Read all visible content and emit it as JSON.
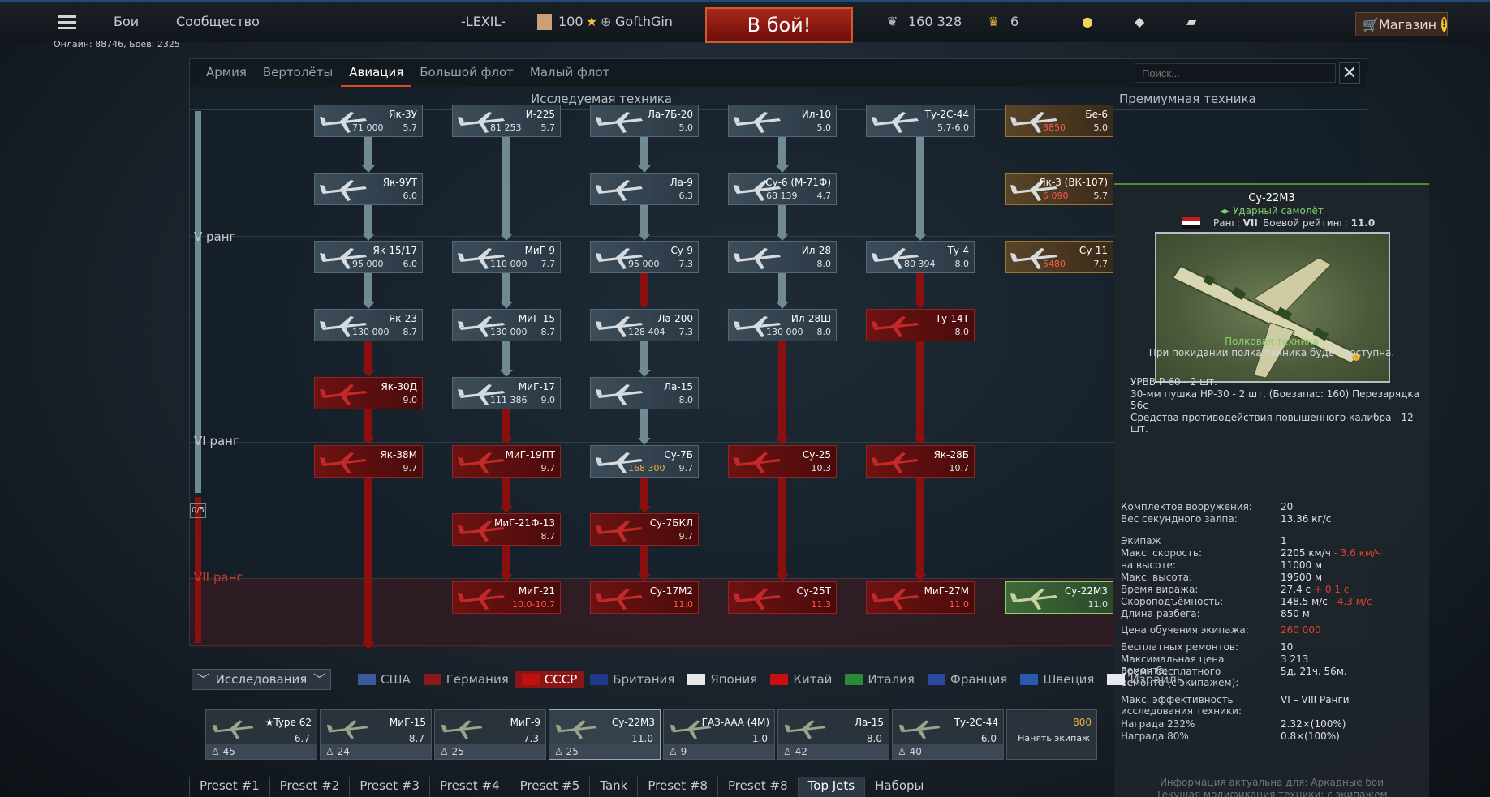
{
  "topbar": {
    "menu_icon": "hamburger-icon",
    "battles": "Бои",
    "community": "Сообщество",
    "squad_tag": "-LEXIL-",
    "level": "100",
    "nickname": "GofthGin",
    "fight_button": "В бой!",
    "silver_lions": "160 328",
    "golden_eagles": "6",
    "shop": "Магазин",
    "online": "Онлайн: 88746, Боёв: 2325"
  },
  "tabs": [
    "Армия",
    "Вертолёты",
    "Авиация",
    "Большой флот",
    "Малый флот"
  ],
  "active_tab": "Авиация",
  "search_placeholder": "Поиск...",
  "sections": {
    "researchable": "Исследуемая техника",
    "premium": "Премиумная техника"
  },
  "ranks": {
    "v": "V ранг",
    "vi": "VI ранг",
    "vii": "VII ранг",
    "progress": "0/5"
  },
  "tree": [
    {
      "id": "yak3u",
      "name": "Як-3У",
      "rp": "71 000",
      "br": "5.7",
      "state": "normal"
    },
    {
      "id": "i225",
      "name": "И-225",
      "rp": "81 253",
      "br": "5.7",
      "state": "normal"
    },
    {
      "id": "la7b20",
      "name": "Ла-7Б-20",
      "rp": "",
      "br": "5.0",
      "state": "normal"
    },
    {
      "id": "il10",
      "name": "Ил-10",
      "rp": "",
      "br": "5.0",
      "state": "normal"
    },
    {
      "id": "tu2s44",
      "name": "Ту-2С-44",
      "rp": "",
      "br": "5.7-6.0",
      "state": "normal"
    },
    {
      "id": "yak9ut",
      "name": "Як-9УТ",
      "rp": "",
      "br": "6.0",
      "state": "normal"
    },
    {
      "id": "la9",
      "name": "Ла-9",
      "rp": "",
      "br": "6.3",
      "state": "normal"
    },
    {
      "id": "su6",
      "name": "Су-6 (М-71Ф)",
      "rp": "68 139",
      "br": "4.7",
      "state": "normal"
    },
    {
      "id": "yak15",
      "name": "Як-15/17",
      "rp": "95 000",
      "br": "6.0",
      "state": "normal"
    },
    {
      "id": "mig9",
      "name": "МиГ-9",
      "rp": "110 000",
      "br": "7.7",
      "state": "normal"
    },
    {
      "id": "su9",
      "name": "Су-9",
      "rp": "95 000",
      "br": "7.3",
      "state": "normal"
    },
    {
      "id": "il28",
      "name": "Ил-28",
      "rp": "",
      "br": "8.0",
      "state": "normal"
    },
    {
      "id": "tu4",
      "name": "Ту-4",
      "rp": "80 394",
      "br": "8.0",
      "state": "normal"
    },
    {
      "id": "yak23",
      "name": "Як-23",
      "rp": "130 000",
      "br": "8.7",
      "state": "normal"
    },
    {
      "id": "mig15",
      "name": "МиГ-15",
      "rp": "130 000",
      "br": "8.7",
      "state": "normal"
    },
    {
      "id": "la200",
      "name": "Ла-200",
      "rp": "128 404",
      "br": "7.3",
      "state": "normal"
    },
    {
      "id": "il28sh",
      "name": "Ил-28Ш",
      "rp": "130 000",
      "br": "8.0",
      "state": "normal"
    },
    {
      "id": "tu14t",
      "name": "Ту-14Т",
      "rp": "",
      "br": "8.0",
      "state": "locked"
    },
    {
      "id": "yak30d",
      "name": "Як-30Д",
      "rp": "",
      "br": "9.0",
      "state": "locked"
    },
    {
      "id": "mig17",
      "name": "МиГ-17",
      "rp": "111 386",
      "br": "9.0",
      "state": "normal"
    },
    {
      "id": "la15",
      "name": "Ла-15",
      "rp": "",
      "br": "8.0",
      "state": "normal"
    },
    {
      "id": "yak38m",
      "name": "Як-38М",
      "rp": "",
      "br": "9.7",
      "state": "locked"
    },
    {
      "id": "mig19pt",
      "name": "МиГ-19ПТ",
      "rp": "",
      "br": "9.7",
      "state": "locked"
    },
    {
      "id": "su7b",
      "name": "Су-7Б",
      "rp": "168 300",
      "br": "9.7",
      "state": "normal",
      "rp_gold": true
    },
    {
      "id": "su25",
      "name": "Су-25",
      "rp": "",
      "br": "10.3",
      "state": "locked"
    },
    {
      "id": "yak28b",
      "name": "Як-28Б",
      "rp": "",
      "br": "10.7",
      "state": "locked"
    },
    {
      "id": "mig21f13",
      "name": "МиГ-21Ф-13",
      "rp": "",
      "br": "8.7",
      "state": "locked"
    },
    {
      "id": "su7bkl",
      "name": "Су-7БКЛ",
      "rp": "",
      "br": "9.7",
      "state": "locked"
    },
    {
      "id": "mig21",
      "name": "МиГ-21",
      "rp": "",
      "br": "10.0-10.7",
      "state": "locked",
      "br_red": true
    },
    {
      "id": "su17m2",
      "name": "Су-17М2",
      "rp": "",
      "br": "11.0",
      "state": "locked",
      "br_red": true
    },
    {
      "id": "su25t",
      "name": "Су-25Т",
      "rp": "",
      "br": "11.3",
      "state": "locked",
      "br_red": true
    },
    {
      "id": "mig27m",
      "name": "МиГ-27М",
      "rp": "",
      "br": "11.0",
      "state": "locked",
      "br_red": true
    }
  ],
  "premium": [
    {
      "id": "be6",
      "name": "Бе-6",
      "rp": "3850",
      "br": "5.0",
      "state": "prem"
    },
    {
      "id": "yak3vk",
      "name": "Як-3 (ВК-107)",
      "rp": "6 090",
      "br": "5.7",
      "state": "prem"
    },
    {
      "id": "su11",
      "name": "Су-11",
      "rp": "5480",
      "br": "7.7",
      "state": "prem"
    },
    {
      "id": "su22m3",
      "name": "Су-22М3",
      "rp": "",
      "br": "11.0",
      "state": "selected"
    }
  ],
  "tooltip": {
    "title": "Су-22М3",
    "role": "Ударный самолёт",
    "rank_label": "Ранг:",
    "rank_value": "VII",
    "br_label": "Боевой рейтинг:",
    "br_value": "11.0",
    "squadron": "Полковая техника",
    "squadron_note": "При покидании полка техника будет доступна.",
    "weapons": [
      "УРВВ Р-60 - 2 шт.",
      "30-мм пушка НР-30 - 2 шт. (Боезапас: 160) Перезарядка 56с",
      "Средства противодействия повышенного калибра - 12 шт."
    ],
    "stats": [
      {
        "label": "Комплектов вооружения:",
        "value": "20"
      },
      {
        "label": "Вес секундного залпа:",
        "value": "13.36 кг/с"
      },
      {
        "label": "Экипаж",
        "value": "1"
      },
      {
        "label": "Макс. скорость:",
        "value": "2205 км/ч",
        "delta": "- 3.6 км/ч"
      },
      {
        "label": "на высоте:",
        "value": "11000 м"
      },
      {
        "label": "Макс. высота:",
        "value": "19500 м"
      },
      {
        "label": "Время виража:",
        "value": "27.4 с",
        "delta": "+ 0.1 с"
      },
      {
        "label": "Скороподъёмность:",
        "value": "148.5 м/с",
        "delta": "- 4.3 м/с"
      },
      {
        "label": "Длина разбега:",
        "value": "850 м"
      },
      {
        "label": "Цена обучения экипажа:",
        "value": "260 000"
      },
      {
        "label": "Бесплатных ремонтов:",
        "value": "10"
      },
      {
        "label": "Максимальная цена ремонта:",
        "value": "3 213"
      },
      {
        "label": "Время бесплатного ремонта (с экипажем):",
        "value": "5д. 21ч. 56м."
      },
      {
        "label": "Макс. эффективность исследования техники:",
        "value": "VI – VIII Ранги"
      },
      {
        "label": "Награда 232%",
        "value": "2.32×(100%)"
      },
      {
        "label": "Награда 80%",
        "value": "0.8×(100%)"
      }
    ],
    "footer1": "Информация актуальна для: Аркадные бои",
    "footer2": "Текущая модификация техники: с экипажем"
  },
  "research_label": "Исследования",
  "nations": [
    "США",
    "Германия",
    "СССР",
    "Британия",
    "Япония",
    "Китай",
    "Италия",
    "Франция",
    "Швеция",
    "Израиль"
  ],
  "active_nation": "СССР",
  "crew_slots": [
    {
      "name": "★Type 62",
      "br": "6.7",
      "crew": "45"
    },
    {
      "name": "МиГ-15",
      "br": "8.7",
      "crew": "24"
    },
    {
      "name": "МиГ-9",
      "br": "7.3",
      "crew": "25"
    },
    {
      "name": "Су-22М3",
      "br": "11.0",
      "crew": "25"
    },
    {
      "name": "ГАЗ-ААА (4М)",
      "br": "1.0",
      "crew": "9"
    },
    {
      "name": "Ла-15",
      "br": "8.0",
      "crew": "42"
    },
    {
      "name": "Ту-2С-44",
      "br": "6.0",
      "crew": "40"
    }
  ],
  "hire_crew": {
    "cost": "800",
    "label": "Нанять экипаж"
  },
  "presets": [
    "Preset #1",
    "Preset #2",
    "Preset #3",
    "Preset #4",
    "Preset #5",
    "Tank",
    "Preset #8",
    "Preset #8",
    "Top Jets",
    "Наборы"
  ],
  "active_preset": "Top Jets",
  "colors": {
    "accent": "#d64b1f",
    "locked": "#8a1010",
    "selected": "#8fcf6a",
    "premium": "#b88a2e"
  }
}
